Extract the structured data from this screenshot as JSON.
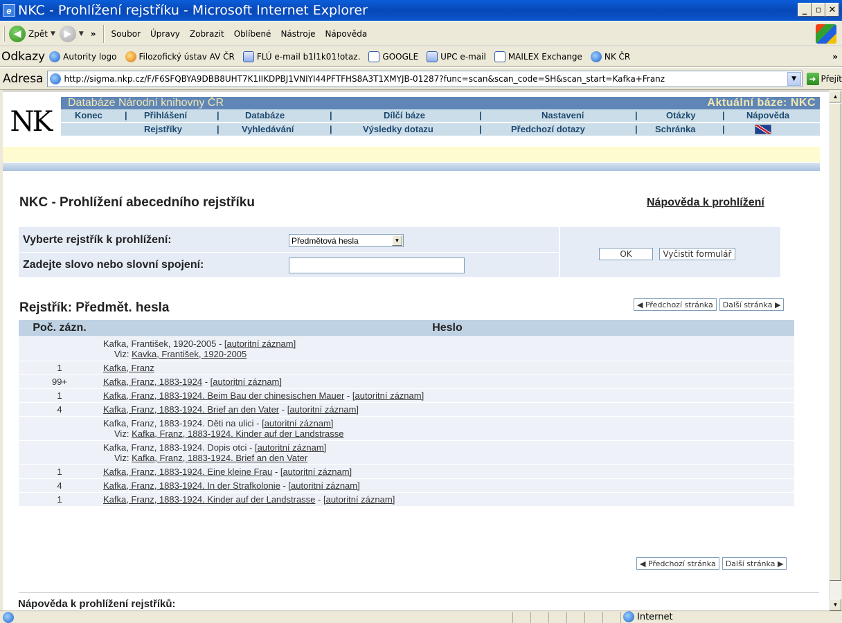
{
  "window": {
    "title": "NKC - Prohlížení rejstříku - Microsoft Internet Explorer"
  },
  "toolbar": {
    "back_label": "Zpět",
    "menu": [
      "Soubor",
      "Úpravy",
      "Zobrazit",
      "Oblíbené",
      "Nástroje",
      "Nápověda"
    ]
  },
  "links_bar": {
    "label": "Odkazy",
    "items": [
      "Autority logo",
      "Filozofický ústav AV ČR",
      "FLÚ e-mail b1l1k01!otaz.",
      "GOOGLE",
      "UPC e-mail",
      "MAILEX Exchange",
      "NK ČR"
    ]
  },
  "address_bar": {
    "label": "Adresa",
    "url": "http://sigma.nkp.cz/F/F6SFQBYA9DBB8UHT7K1IIKDPBJ1VNIYI44PFTFHS8A3T1XMYJB-01287?func=scan&scan_code=SH&scan_start=Kafka+Franz",
    "go_label": "Přejít"
  },
  "nk_header": {
    "logo": "NK",
    "db_title": "Databáze Národní knihovny ČR",
    "current_db": "Aktuální báze: NKC",
    "row1": [
      "Konec",
      "Přihlášení",
      "Databáze",
      "Dílčí báze",
      "Nastavení",
      "Otázky",
      "Nápověda"
    ],
    "row2": [
      "Rejstříky",
      "Vyhledávání",
      "Výsledky dotazu",
      "Předchozí dotazy",
      "Schránka"
    ]
  },
  "page": {
    "title": "NKC - Prohlížení abecedního rejstříku",
    "help_link": "Nápověda k prohlížení"
  },
  "form": {
    "select_label": "Vyberte rejstřík k prohlížení:",
    "select_value": "Předmětová hesla",
    "input_label": "Zadejte slovo nebo slovní spojení:",
    "input_value": "",
    "ok_label": "OK",
    "clear_label": "Vyčistit formulář"
  },
  "register": {
    "title": "Rejstřík:  Předmět. hesla",
    "prev_label": "◀ Předchozí stránka",
    "next_label": "Další stránka ▶",
    "col_count": "Poč. zázn.",
    "col_entry": "Heslo",
    "see_prefix": "Viz:",
    "authority_link": "[autoritní záznam]",
    "rows": [
      {
        "count": "",
        "entry": "Kafka, František, 1920-2005",
        "entry_link": false,
        "authority": true,
        "see": "Kavka, František, 1920-2005"
      },
      {
        "count": "1",
        "entry": "Kafka, Franz",
        "entry_link": true,
        "authority": false,
        "see": ""
      },
      {
        "count": "99+",
        "entry": "Kafka, Franz, 1883-1924",
        "entry_link": true,
        "authority": true,
        "see": ""
      },
      {
        "count": "1",
        "entry": "Kafka, Franz, 1883-1924. Beim Bau der chinesischen Mauer",
        "entry_link": true,
        "authority": true,
        "see": ""
      },
      {
        "count": "4",
        "entry": "Kafka, Franz, 1883-1924. Brief an den Vater",
        "entry_link": true,
        "authority": true,
        "see": ""
      },
      {
        "count": "",
        "entry": "Kafka, Franz, 1883-1924. Děti na ulici",
        "entry_link": false,
        "authority": true,
        "see": "Kafka, Franz, 1883-1924. Kinder auf der Landstrasse"
      },
      {
        "count": "",
        "entry": "Kafka, Franz, 1883-1924. Dopis otci",
        "entry_link": false,
        "authority": true,
        "see": "Kafka, Franz, 1883-1924. Brief an den Vater"
      },
      {
        "count": "1",
        "entry": "Kafka, Franz, 1883-1924. Eine kleine Frau",
        "entry_link": true,
        "authority": true,
        "see": ""
      },
      {
        "count": "4",
        "entry": "Kafka, Franz, 1883-1924. In der Strafkolonie",
        "entry_link": true,
        "authority": true,
        "see": ""
      },
      {
        "count": "1",
        "entry": "Kafka, Franz, 1883-1924. Kinder auf der Landstrasse",
        "entry_link": true,
        "authority": true,
        "see": ""
      }
    ]
  },
  "footer": {
    "help_heading": "Nápověda k prohlížení rejstříků:"
  },
  "status_bar": {
    "zone": "Internet"
  }
}
